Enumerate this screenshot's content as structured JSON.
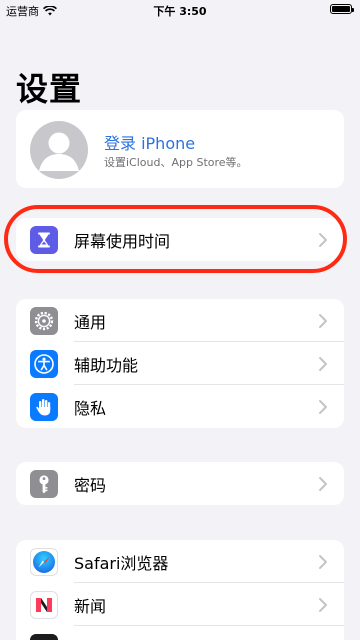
{
  "status_bar": {
    "carrier": "运营商",
    "time": "下午 3:50"
  },
  "page": {
    "title": "设置"
  },
  "profile": {
    "name": "登录 iPhone",
    "subtitle": "设置iCloud、App Store等。"
  },
  "screen_time": {
    "label": "屏幕使用时间",
    "icon": "hourglass-icon",
    "color": "#5e5ce6"
  },
  "group_general": [
    {
      "label": "通用",
      "icon": "gear-icon",
      "color": "#8e8e93"
    },
    {
      "label": "辅助功能",
      "icon": "accessibility-icon",
      "color": "#0a7aff"
    },
    {
      "label": "隐私",
      "icon": "hand-icon",
      "color": "#0a7aff"
    }
  ],
  "passwords": {
    "label": "密码",
    "icon": "key-icon",
    "color": "#8e8e93"
  },
  "group_apps": [
    {
      "label": "Safari浏览器",
      "icon": "compass-icon",
      "color": "#ffffff"
    },
    {
      "label": "新闻",
      "icon": "news-icon",
      "color": "#ffffff"
    }
  ],
  "highlight_color": "#ff2a13"
}
